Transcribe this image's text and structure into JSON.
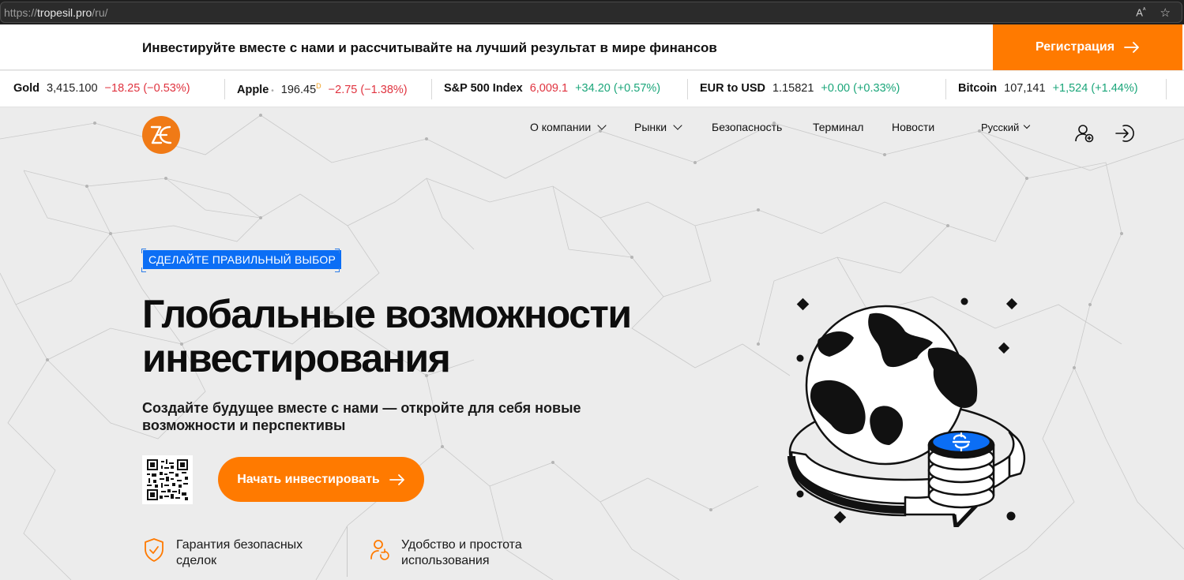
{
  "browser": {
    "url_prefix": "https://",
    "url_host": "tropesil.pro",
    "url_path": "/ru/",
    "read_aloud_icon": "A´¹",
    "favorite_icon": "☆"
  },
  "promo": {
    "text": "Инвестируйте вместе с нами и рассчитывайте на лучший результат в мире финансов",
    "register_label": "Регистрация",
    "arrow_icon": "→"
  },
  "ticker": [
    {
      "name": "Gold",
      "price": "3,415.100",
      "change": "−18.25 (−0.53%)",
      "direction": "down"
    },
    {
      "name": "Apple",
      "price": "196.45",
      "marker": "D",
      "change": "−2.75 (−1.38%)",
      "direction": "down"
    },
    {
      "name": "S&P 500 Index",
      "price": "6,009.1",
      "change": "+34.20 (+0.57%)",
      "direction": "up"
    },
    {
      "name": "EUR to USD",
      "price": "1.15821",
      "change": "+0.00 (+0.33%)",
      "direction": "up"
    },
    {
      "name": "Bitcoin",
      "price": "107,141",
      "change": "+1,524 (+1.44%)",
      "direction": "up"
    }
  ],
  "nav": {
    "items": [
      {
        "label": "О компании",
        "dropdown": true
      },
      {
        "label": "Рынки",
        "dropdown": true
      },
      {
        "label": "Безопасность",
        "dropdown": false
      },
      {
        "label": "Терминал",
        "dropdown": false
      },
      {
        "label": "Новости",
        "dropdown": false
      }
    ],
    "language": "Русский"
  },
  "hero": {
    "badge": "СДЕЛАЙТЕ ПРАВИЛЬНЫЙ ВЫБОР",
    "headline_line1": "Глобальные возможности",
    "headline_line2": "инвестирования",
    "subline": "Создайте будущее вместе с нами — откройте для себя новые возможности и перспективы",
    "cta_label": "Начать инвестировать",
    "features": [
      {
        "line1": "Гарантия безопасных",
        "line2": "сделок",
        "icon": "shield-check-icon"
      },
      {
        "line1": "Удобство и простота",
        "line2": "использования",
        "icon": "user-refresh-icon"
      }
    ]
  },
  "colors": {
    "accent": "#ff7a00",
    "badge_blue": "#0b6ef5",
    "down": "#e0333f",
    "up": "#1ba67a",
    "background": "#ececec"
  }
}
